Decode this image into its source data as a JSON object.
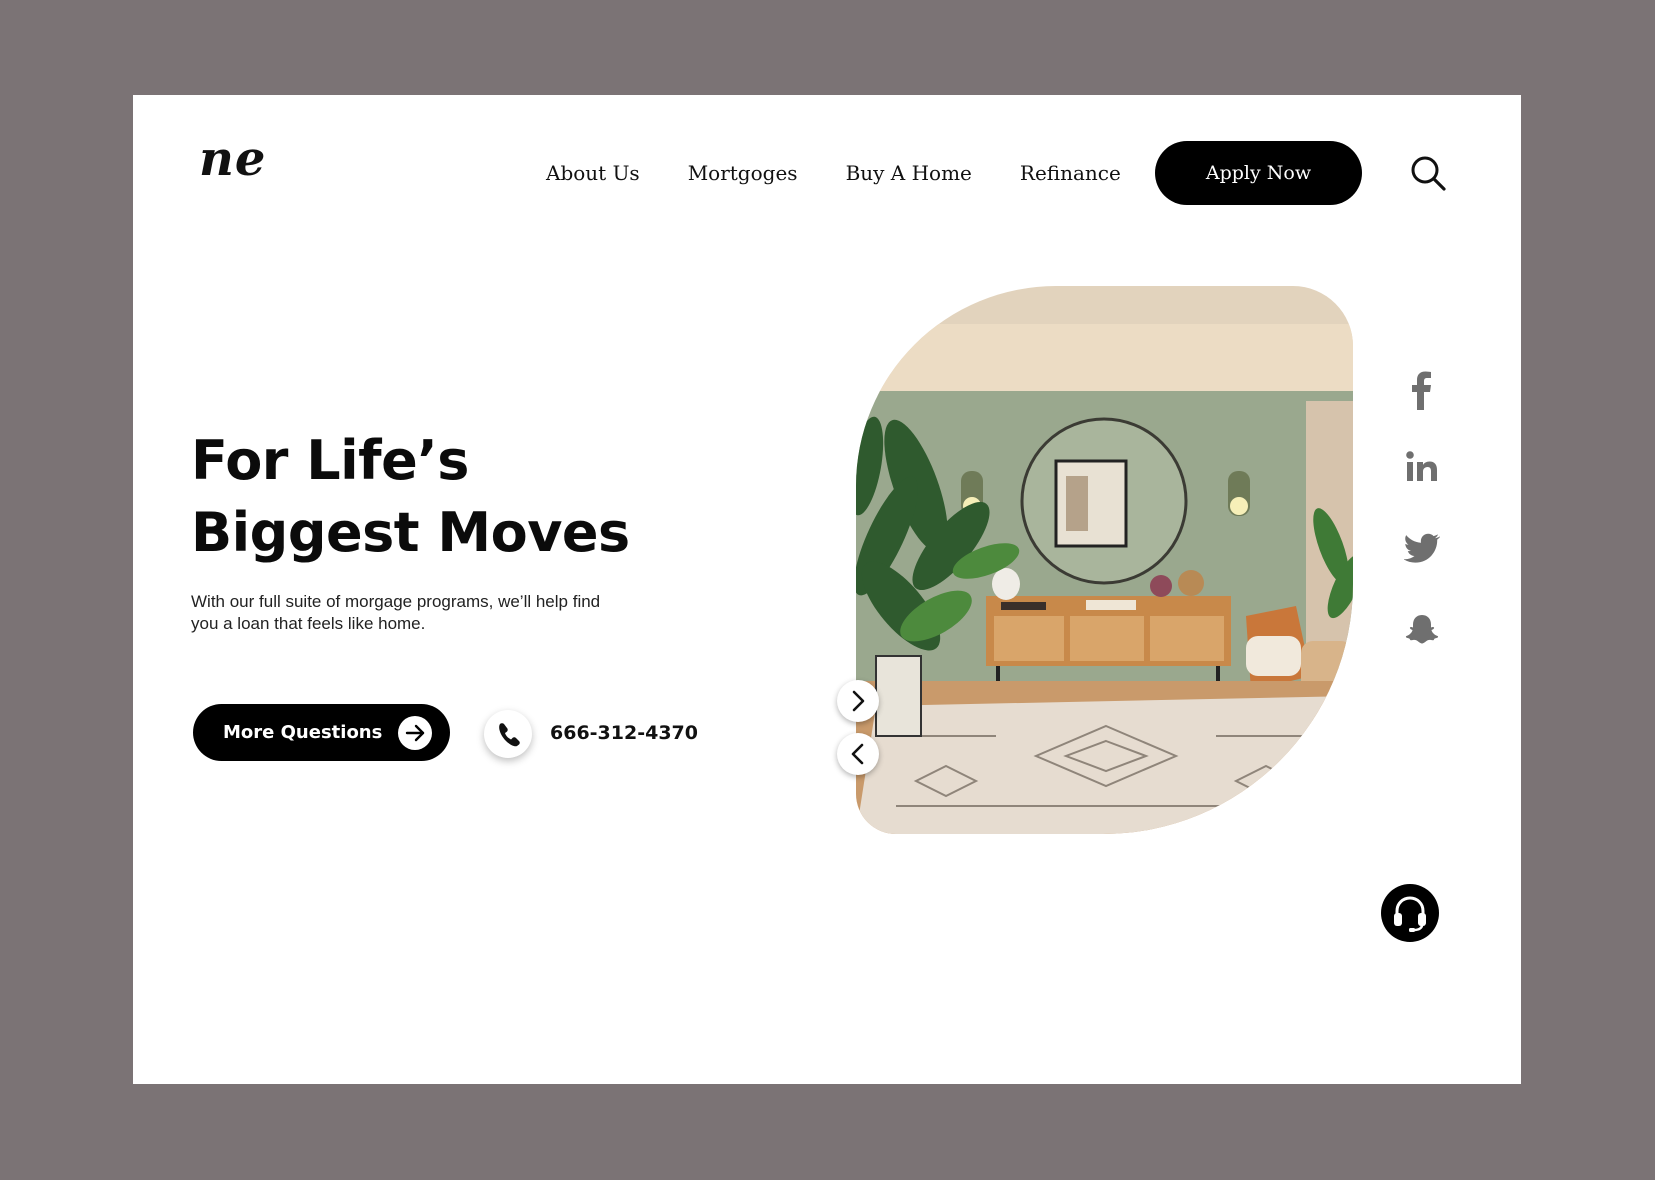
{
  "brand": {
    "logo_text": "ne"
  },
  "nav": {
    "items": [
      {
        "label": "About Us"
      },
      {
        "label": "Mortgoges"
      },
      {
        "label": "Buy A Home"
      },
      {
        "label": "Refinance"
      }
    ],
    "apply_label": "Apply Now",
    "search_icon": "search-icon"
  },
  "hero": {
    "headline_line1": "For Life’s",
    "headline_line2": "Biggest Moves",
    "subtext": "With our full suite of morgage programs, we’ll help find you a loan that feels like home.",
    "cta_label": "More Questions",
    "cta_icon": "arrow-right-icon",
    "phone_icon": "phone-icon",
    "phone_number": "666-312-4370",
    "image_subject": "living room interior"
  },
  "slider": {
    "next_icon": "chevron-right-icon",
    "prev_icon": "chevron-left-icon"
  },
  "social": [
    "facebook-icon",
    "linkedin-icon",
    "twitter-icon",
    "snapchat-icon"
  ],
  "support": {
    "icon": "headset-icon"
  },
  "colors": {
    "background": "#7b7375",
    "card": "#ffffff",
    "primary": "#000000",
    "social_icon": "#6f6f6f"
  }
}
